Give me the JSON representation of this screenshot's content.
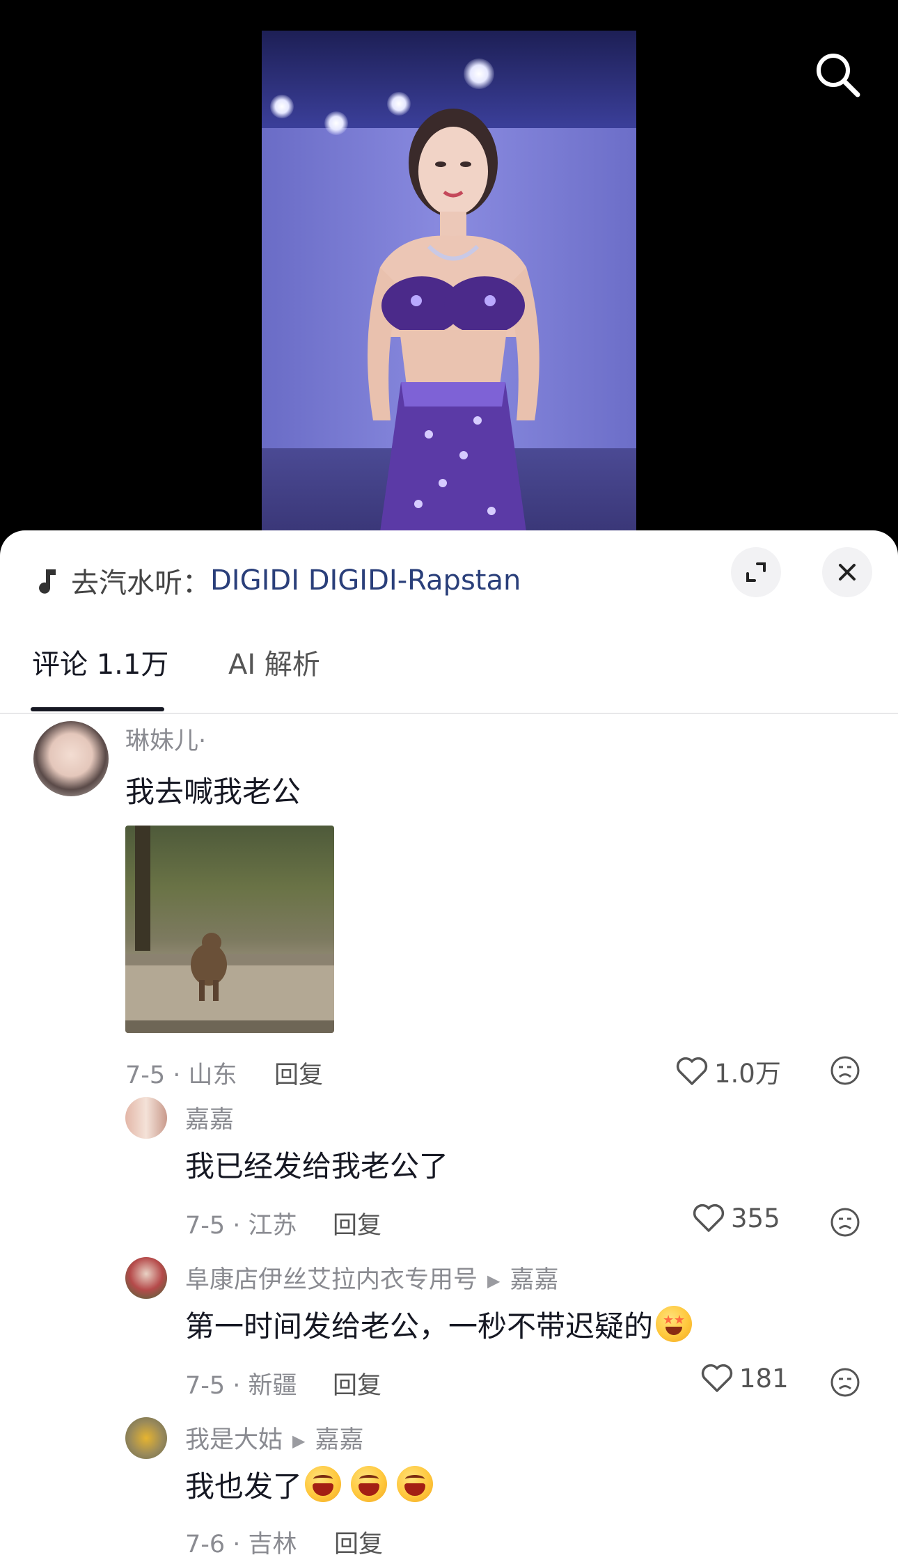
{
  "video": {
    "search_icon": "search-icon"
  },
  "sheet": {
    "music_prefix": "去汽水听：",
    "music_song": "DIGIDI DIGIDI-Rapstan",
    "expand_icon": "expand-icon",
    "close_icon": "close-icon"
  },
  "tabs": [
    {
      "label": "评论 1.1万",
      "active": true
    },
    {
      "label": "AI 解析",
      "active": false
    }
  ],
  "comments": [
    {
      "author": "琳妹儿·",
      "text": "我去喊我老公",
      "date_location": "7-5 · 山东",
      "reply": "回复",
      "likes": "1.0万",
      "has_gif": true
    },
    {
      "author": "嘉嘉",
      "text": "我已经发给我老公了",
      "date_location": "7-5 · 江苏",
      "reply": "回复",
      "likes": "355"
    },
    {
      "author": "阜康店伊丝艾拉内衣专用号",
      "reply_to": "嘉嘉",
      "text": "第一时间发给老公，一秒不带迟疑的",
      "date_location": "7-5 · 新疆",
      "reply": "回复",
      "likes": "181"
    },
    {
      "author": "我是大姑",
      "reply_to": "嘉嘉",
      "text": "我也发了",
      "date_location": "7-6 · 吉林",
      "reply": "回复"
    }
  ],
  "colors": {
    "accent_link": "#2a3f7a",
    "muted_text": "#8a8b91"
  }
}
